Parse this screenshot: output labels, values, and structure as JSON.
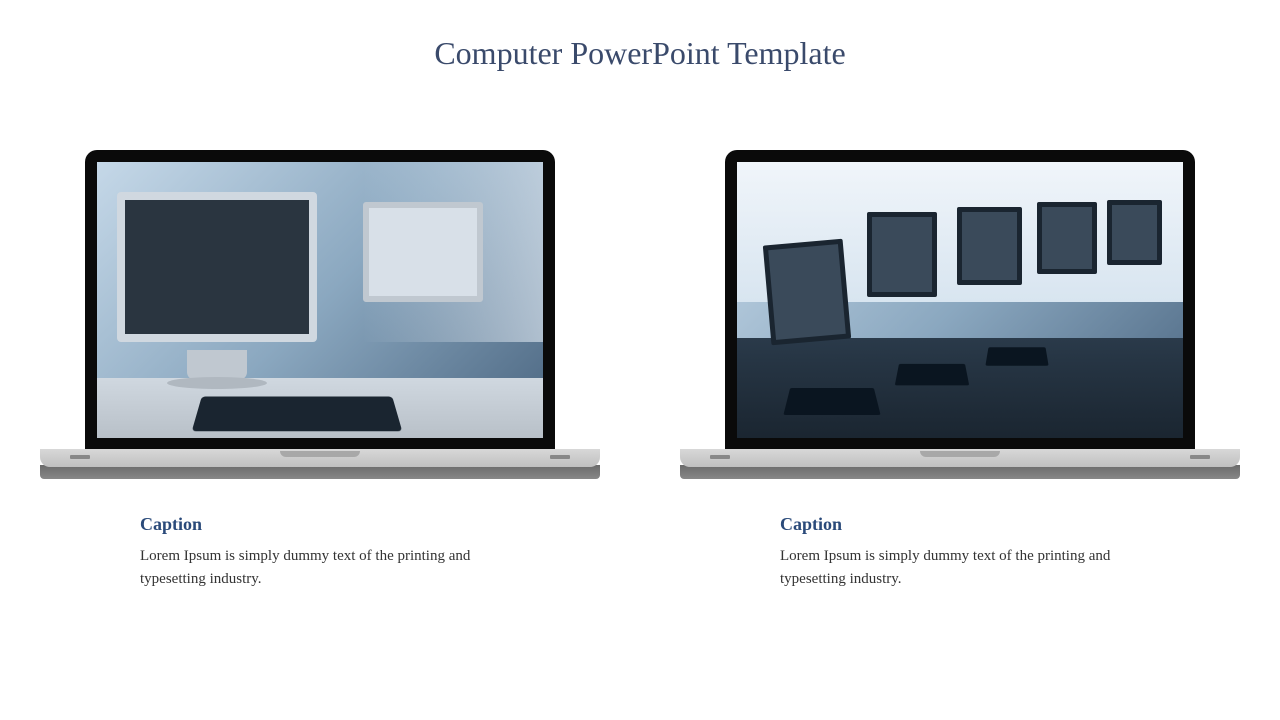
{
  "title": "Computer PowerPoint Template",
  "panels": [
    {
      "caption_label": "Caption",
      "caption_text": "Lorem Ipsum is simply dummy text of the printing and typesetting industry."
    },
    {
      "caption_label": "Caption",
      "caption_text": "Lorem Ipsum is simply dummy text of the printing and typesetting industry."
    }
  ]
}
